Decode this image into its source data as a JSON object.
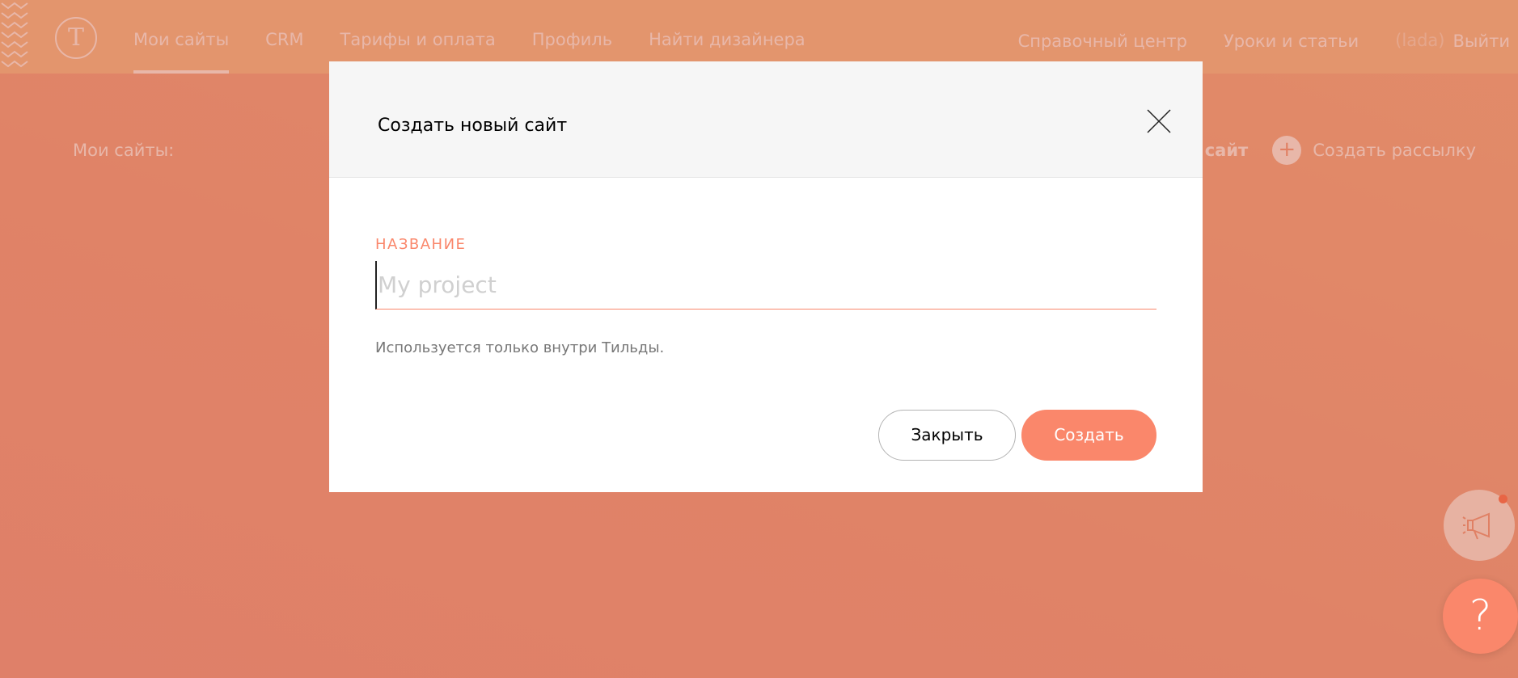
{
  "app": {
    "logo_letter": "T"
  },
  "nav": {
    "left": [
      "Мои сайты",
      "CRM",
      "Тарифы и оплата",
      "Профиль",
      "Найти дизайнера"
    ],
    "right": [
      "Справочный центр",
      "Уроки и статьи"
    ],
    "user_name": "(lada)",
    "logout": "Выйти"
  },
  "page": {
    "subheader": "Мои сайты:",
    "create_site_partial": "й сайт",
    "create_newsletter": "Создать рассылку",
    "plus_icon": "+"
  },
  "modal": {
    "title": "Создать новый сайт",
    "field_label": "НАЗВАНИЕ",
    "field_value": "",
    "field_placeholder": "My project",
    "hint": "Используется только внутри Тильды.",
    "close_button": "Закрыть",
    "create_button": "Создать"
  },
  "help": {
    "icon": "?"
  },
  "colors": {
    "accent": "#fa876b",
    "header_bg": "#f6f6f6"
  }
}
